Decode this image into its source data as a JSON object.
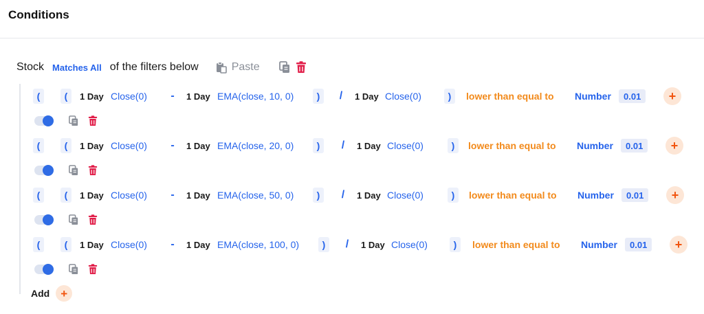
{
  "header": {
    "title": "Conditions"
  },
  "top": {
    "stock_label": "Stock",
    "match_mode": "Matches All",
    "suffix": "of the filters below",
    "paste_label": "Paste"
  },
  "colors": {
    "accent": "#2563eb",
    "comparator": "#f28a1b",
    "danger": "#e11d48",
    "add": "#f1540f"
  },
  "conditions": [
    {
      "open1": "(",
      "open2": "(",
      "timeframe1": "1 Day",
      "left_fn": "Close(0)",
      "minus": "-",
      "timeframe2": "1 Day",
      "ema_fn": "EMA(close, 10, 0)",
      "close1": ")",
      "divide": "/",
      "timeframe3": "1 Day",
      "right_fn": "Close(0)",
      "close2": ")",
      "comparator": "lower than equal to",
      "value_type": "Number",
      "value": "0.01",
      "enabled": true
    },
    {
      "open1": "(",
      "open2": "(",
      "timeframe1": "1 Day",
      "left_fn": "Close(0)",
      "minus": "-",
      "timeframe2": "1 Day",
      "ema_fn": "EMA(close, 20, 0)",
      "close1": ")",
      "divide": "/",
      "timeframe3": "1 Day",
      "right_fn": "Close(0)",
      "close2": ")",
      "comparator": "lower than equal to",
      "value_type": "Number",
      "value": "0.01",
      "enabled": true
    },
    {
      "open1": "(",
      "open2": "(",
      "timeframe1": "1 Day",
      "left_fn": "Close(0)",
      "minus": "-",
      "timeframe2": "1 Day",
      "ema_fn": "EMA(close, 50, 0)",
      "close1": ")",
      "divide": "/",
      "timeframe3": "1 Day",
      "right_fn": "Close(0)",
      "close2": ")",
      "comparator": "lower than equal to",
      "value_type": "Number",
      "value": "0.01",
      "enabled": true
    },
    {
      "open1": "(",
      "open2": "(",
      "timeframe1": "1 Day",
      "left_fn": "Close(0)",
      "minus": "-",
      "timeframe2": "1 Day",
      "ema_fn": "EMA(close, 100, 0)",
      "close1": ")",
      "divide": "/",
      "timeframe3": "1 Day",
      "right_fn": "Close(0)",
      "close2": ")",
      "comparator": "lower than equal to",
      "value_type": "Number",
      "value": "0.01",
      "enabled": true
    }
  ],
  "add": {
    "label": "Add",
    "plus": "+"
  },
  "icons": {
    "plus": "+",
    "copy": "copy-icon",
    "trash": "trash-icon",
    "paste": "clipboard-icon"
  }
}
